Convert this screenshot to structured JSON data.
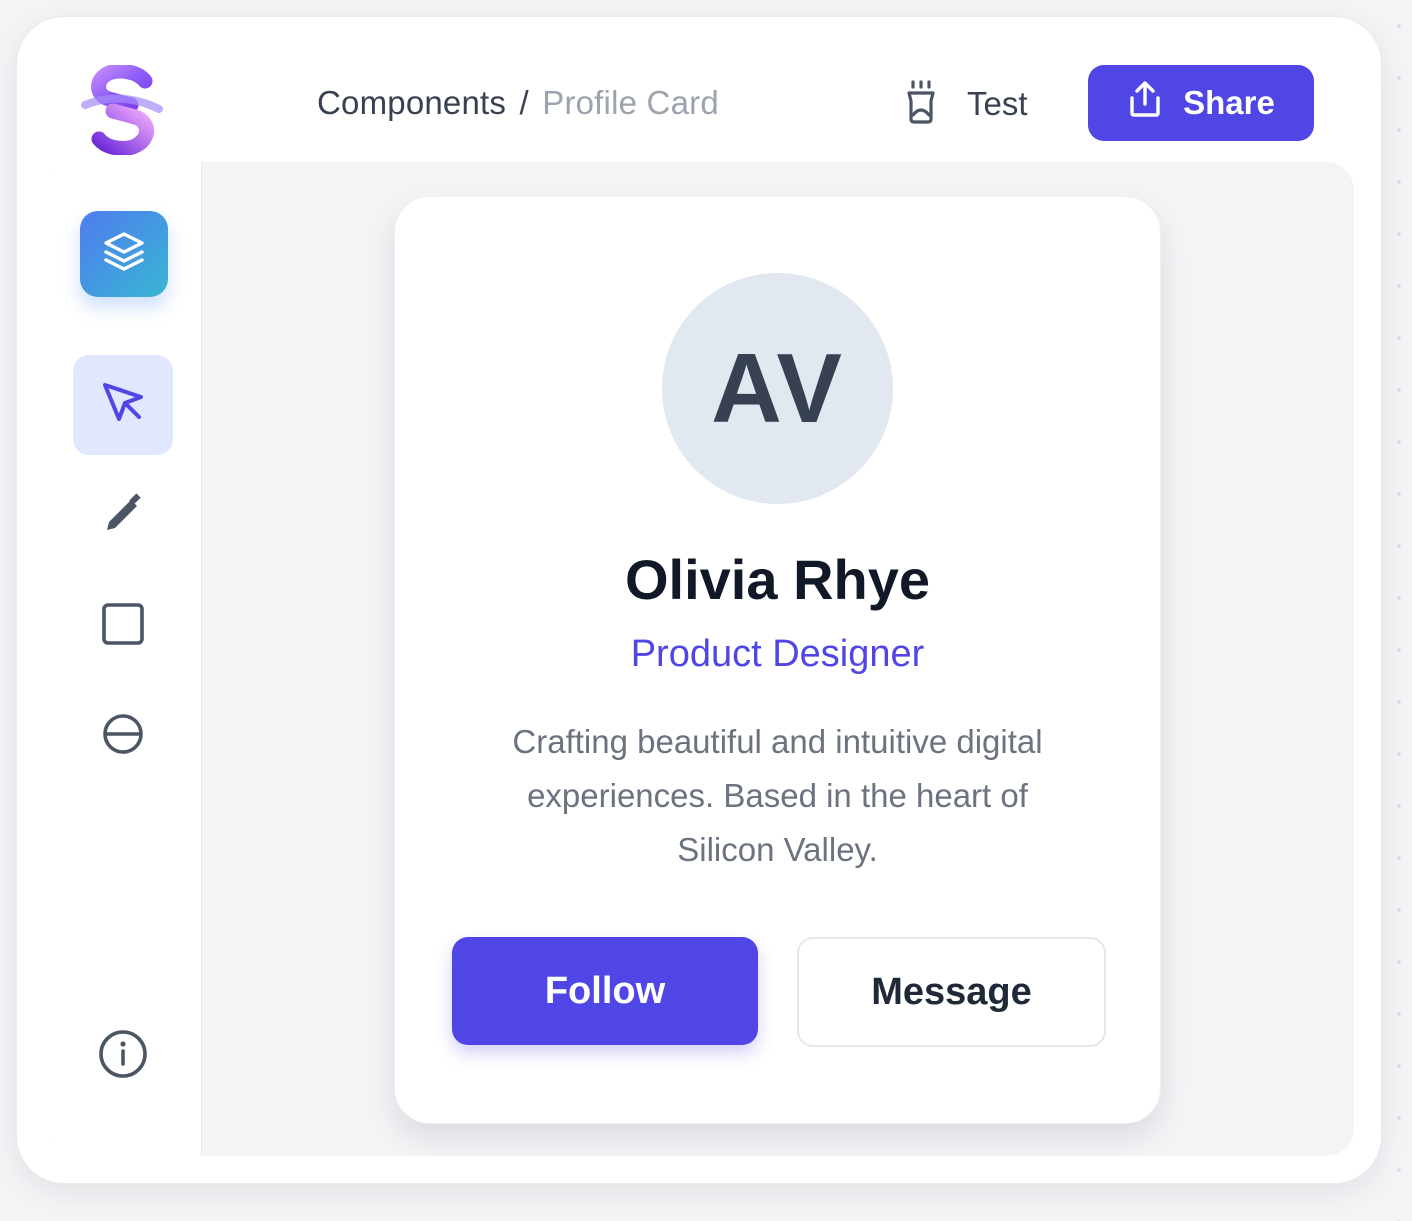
{
  "header": {
    "breadcrumb": {
      "parent": "Components",
      "separator": "/",
      "current": "Profile Card"
    },
    "test_label": "Test",
    "share_label": "Share"
  },
  "sidebar": {
    "items": [
      {
        "name": "layers",
        "icon": "layers-icon"
      },
      {
        "name": "select",
        "icon": "cursor-arrow-icon",
        "active": true
      },
      {
        "name": "pen",
        "icon": "pen-icon"
      },
      {
        "name": "rectangle",
        "icon": "square-icon"
      },
      {
        "name": "ellipse",
        "icon": "circle-line-icon"
      },
      {
        "name": "info",
        "icon": "info-icon"
      }
    ]
  },
  "profile": {
    "initials": "AV",
    "name": "Olivia Rhye",
    "role": "Product Designer",
    "bio": "Crafting beautiful and intuitive digital experiences. Based in the heart of Silicon Valley.",
    "follow_label": "Follow",
    "message_label": "Message"
  },
  "colors": {
    "accent": "#4f46e5",
    "active_tool_bg": "#e0e7ff",
    "canvas_bg": "#f3f4f6",
    "avatar_bg": "#e2e8f0"
  }
}
